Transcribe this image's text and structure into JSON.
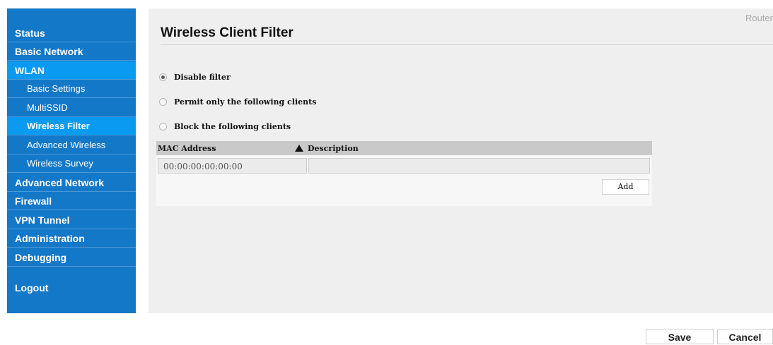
{
  "sidebar": {
    "items": [
      {
        "label": "Status"
      },
      {
        "label": "Basic Network"
      },
      {
        "label": "WLAN"
      },
      {
        "label": "Basic Settings"
      },
      {
        "label": "MultiSSID"
      },
      {
        "label": "Wireless Filter"
      },
      {
        "label": "Advanced Wireless"
      },
      {
        "label": "Wireless Survey"
      },
      {
        "label": "Advanced Network"
      },
      {
        "label": "Firewall"
      },
      {
        "label": "VPN Tunnel"
      },
      {
        "label": "Administration"
      },
      {
        "label": "Debugging"
      },
      {
        "label": "Logout"
      }
    ]
  },
  "header": {
    "router_label": "Router",
    "title": "Wireless Client Filter"
  },
  "filter_options": [
    {
      "label": "Disable filter",
      "checked": true
    },
    {
      "label": "Permit only the following clients",
      "checked": false
    },
    {
      "label": "Block the following clients",
      "checked": false
    }
  ],
  "table": {
    "columns": [
      "MAC Address",
      "Description"
    ],
    "sort_icon": "triangle-up-icon",
    "row": {
      "mac_placeholder": "00:00:00:00:00:00",
      "description": ""
    },
    "add_label": "Add"
  },
  "footer": {
    "save_label": "Save",
    "cancel_label": "Cancel"
  },
  "colors": {
    "sidebar": "#1478c8",
    "sidebar_active": "#0a9bf0",
    "panel": "#efefef"
  }
}
